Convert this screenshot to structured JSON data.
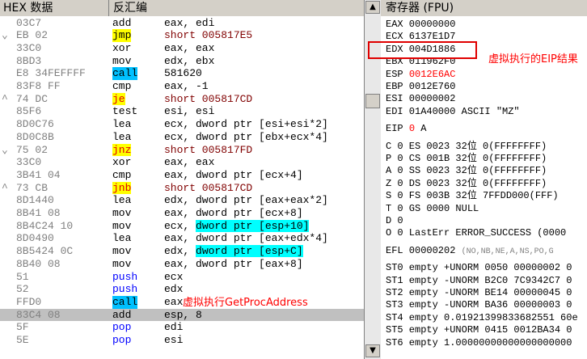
{
  "header": {
    "col_hex": "HEX 数据",
    "col_dis": "反汇编",
    "col_regs": "寄存器 (FPU)"
  },
  "scroll": {
    "up_glyph": "▲",
    "down_glyph": "▼"
  },
  "disasm": [
    {
      "hex": "03C7",
      "mn": "add",
      "op": "eax, edi"
    },
    {
      "arrow": "⌄",
      "hex": "EB 02",
      "mn": "jmp",
      "op": "short 005817E5",
      "mnstyle": "yel"
    },
    {
      "hex": "33C0",
      "mn": "xor",
      "op": "eax, eax"
    },
    {
      "hex": "8BD3",
      "mn": "mov",
      "op": "edx, ebx"
    },
    {
      "hex": "E8 34FEFFFF",
      "mn": "call",
      "op": "\u0001581620",
      "mnstyle": "cyan"
    },
    {
      "hex": "83F8 FF",
      "mn": "cmp",
      "op": "eax, -1"
    },
    {
      "arrow": "^",
      "hex": "74 DC",
      "mn": "je",
      "op": "short 005817CD",
      "mnstyle": "yj"
    },
    {
      "hex": "85F6",
      "mn": "test",
      "op": "esi, esi"
    },
    {
      "hex": "8D0C76",
      "mn": "lea",
      "op": "ecx, dword ptr [esi+esi*2]"
    },
    {
      "hex": "8D0C8B",
      "mn": "lea",
      "op": "ecx, dword ptr [ebx+ecx*4]"
    },
    {
      "arrow": "⌄",
      "hex": "75 02",
      "mn": "jnz",
      "op": "short 005817FD",
      "mnstyle": "yj"
    },
    {
      "hex": "33C0",
      "mn": "xor",
      "op": "eax, eax"
    },
    {
      "hex": "3B41 04",
      "mn": "cmp",
      "op": "eax, dword ptr [ecx+4]"
    },
    {
      "arrow": "^",
      "hex": "73 CB",
      "mn": "jnb",
      "op": "short 005817CD",
      "mnstyle": "yj"
    },
    {
      "hex": "8D1440",
      "mn": "lea",
      "op": "edx, dword ptr [eax+eax*2]"
    },
    {
      "hex": "8B41 08",
      "mn": "mov",
      "op": "eax, dword ptr [ecx+8]"
    },
    {
      "hex": "8B4C24 10",
      "mn": "mov",
      "op": "ecx, dword ptr [esp+10]",
      "opstyle": "esp"
    },
    {
      "hex": "8D0490",
      "mn": "lea",
      "op": "eax, dword ptr [eax+edx*4]"
    },
    {
      "hex": "8B5424 0C",
      "mn": "mov",
      "op": "edx, dword ptr [esp+C]",
      "opstyle": "esp"
    },
    {
      "hex": "8B40 08",
      "mn": "mov",
      "op": "eax, dword ptr [eax+8]"
    },
    {
      "hex": "51",
      "mn": "push",
      "op": "ecx",
      "mnstyle": "blue"
    },
    {
      "hex": "52",
      "mn": "push",
      "op": "edx",
      "mnstyle": "blue"
    },
    {
      "hex": "FFD0",
      "mn": "call",
      "op": "eax",
      "mnstyle": "cyan"
    },
    {
      "hex": "83C4 08",
      "mn": "add",
      "op": "esp, 8",
      "sel": true
    },
    {
      "hex": "5F",
      "mn": "pop",
      "op": "edi",
      "mnstyle": "blue"
    },
    {
      "hex": "5E",
      "mn": "pop",
      "op": "esi",
      "mnstyle": "blue"
    }
  ],
  "annotations": {
    "getproc": "虚拟执行GetProcAddress",
    "eip": "虚拟执行的EIP结果"
  },
  "registers": [
    {
      "t": "EAX 00000000"
    },
    {
      "t": "ECX 6137E1D7"
    },
    {
      "t": "EDX 004D1886",
      "boxed": true
    },
    {
      "t": "EBX 011962F0"
    },
    {
      "pre": "ESP ",
      "red": "0012E6AC"
    },
    {
      "t": "EBP 0012E760"
    },
    {
      "t": "ESI 00000002"
    },
    {
      "t": "EDI 01A40000 ASCII \"MZ\""
    },
    {
      "gap": true
    },
    {
      "pre": "EIP ",
      "red": "0",
      "post": "                 A"
    },
    {
      "gap": true
    },
    {
      "t": "C 0   ES 0023 32位 0(FFFFFFFF)"
    },
    {
      "t": "P 0   CS 001B 32位 0(FFFFFFFF)"
    },
    {
      "t": "A 0   SS 0023 32位 0(FFFFFFFF)"
    },
    {
      "t": "Z 0   DS 0023 32位 0(FFFFFFFF)"
    },
    {
      "t": "S 0   FS 003B 32位 7FFDD000(FFF)"
    },
    {
      "t": "T 0   GS 0000 NULL"
    },
    {
      "t": "D 0"
    },
    {
      "t": "O 0   LastErr ERROR_SUCCESS (0000"
    },
    {
      "gap": true
    },
    {
      "pre": "EFL 00000202 ",
      "gray": "(NO,NB,NE,A,NS,PO,G"
    },
    {
      "gap": true
    },
    {
      "t": "ST0 empty +UNORM 0050 00000002 0"
    },
    {
      "t": "ST1 empty -UNORM B2C0 7C9342C7 0"
    },
    {
      "t": "ST2 empty -UNORM BE14 00000045 0"
    },
    {
      "t": "ST3 empty -UNORM BA36 00000003 0"
    },
    {
      "t": "ST4 empty 0.01921399833682551 60e"
    },
    {
      "t": "ST5 empty +UNORM 0415 0012BA34 0"
    },
    {
      "t": "ST6 empty 1.00000000000000000000"
    }
  ]
}
